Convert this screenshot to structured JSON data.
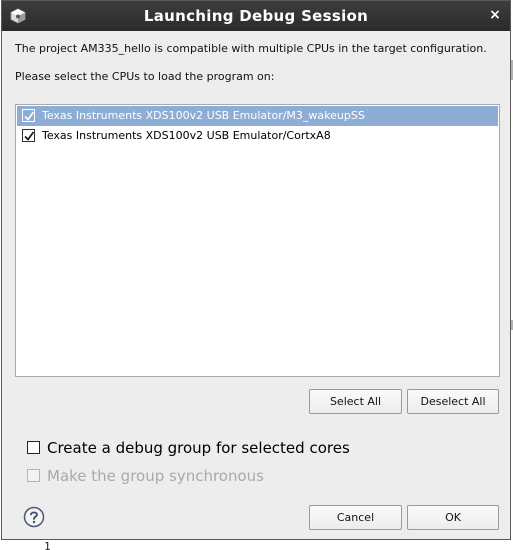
{
  "window": {
    "title": "Launching Debug Session",
    "close_glyph": "×"
  },
  "messages": {
    "compatible": "The project AM335_hello is compatible with multiple CPUs in the target configuration.",
    "select_prompt": "Please select the CPUs to load the program on:"
  },
  "cpu_list": {
    "items": [
      {
        "label": "Texas Instruments XDS100v2 USB Emulator/M3_wakeupSS",
        "checked": true,
        "selected": true
      },
      {
        "label": "Texas Instruments XDS100v2 USB Emulator/CortxA8",
        "checked": true,
        "selected": false
      }
    ]
  },
  "buttons": {
    "select_all": "Select All",
    "deselect_all": "Deselect All",
    "cancel": "Cancel",
    "ok": "OK"
  },
  "options": {
    "create_group": {
      "label": "Create a debug group for selected cores",
      "checked": false,
      "enabled": true
    },
    "synchronous": {
      "label": "Make the group synchronous",
      "checked": false,
      "enabled": false
    }
  },
  "background": {
    "peek_text": "1"
  },
  "colors": {
    "titlebar": "#333333",
    "selection": "#8eadd4",
    "dialog_bg": "#ededed"
  },
  "icons": {
    "app": "ccs-cube-icon",
    "close": "close-icon",
    "help": "help-question-icon",
    "check": "checkmark-icon"
  }
}
